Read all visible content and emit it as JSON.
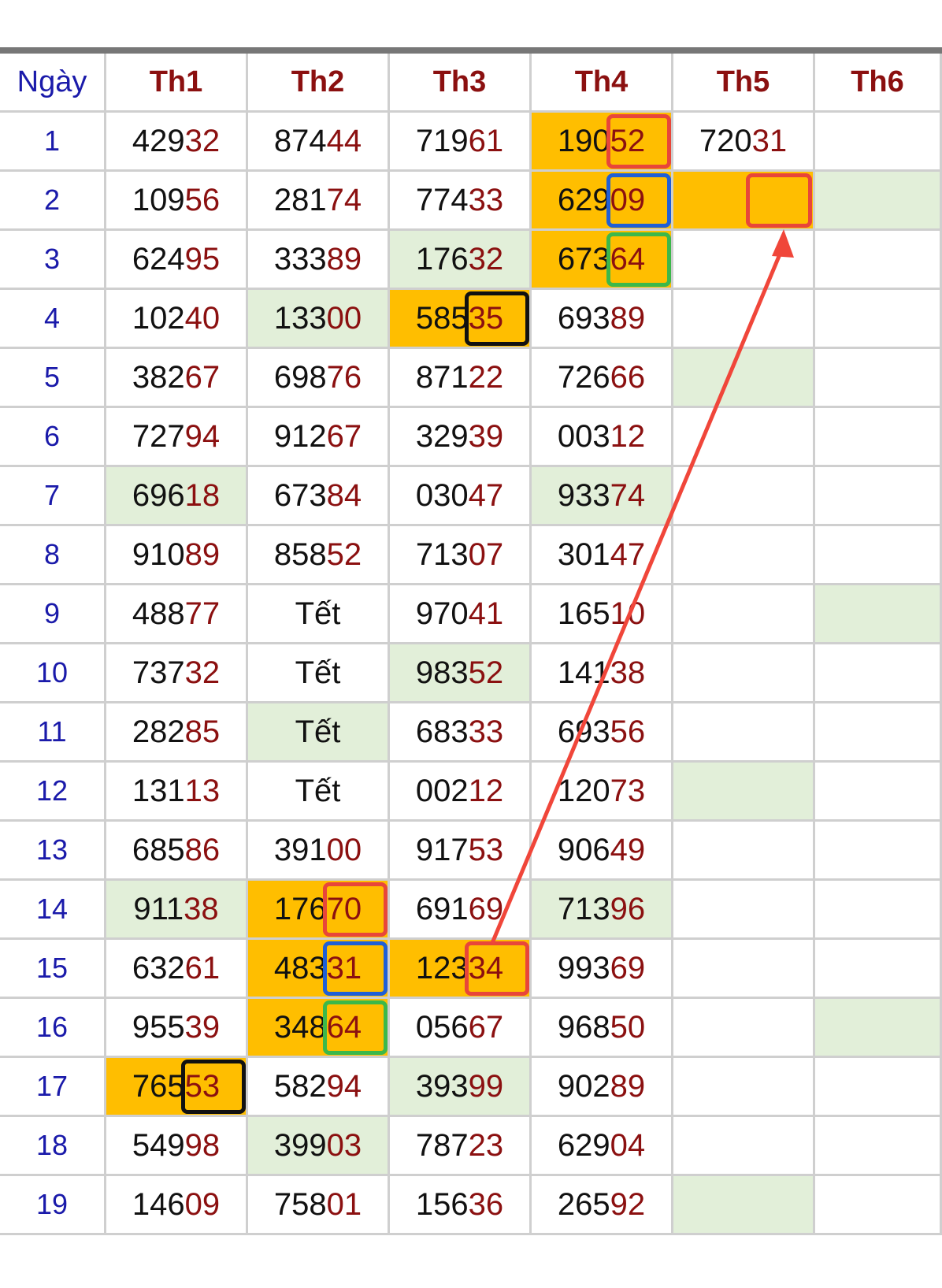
{
  "headers": [
    "Ngày",
    "Th1",
    "Th2",
    "Th3",
    "Th4",
    "Th5",
    "Th6"
  ],
  "rows": [
    {
      "day": "1",
      "values": [
        "42932",
        "87444",
        "71961",
        "19052",
        "72031",
        ""
      ]
    },
    {
      "day": "2",
      "values": [
        "10956",
        "28174",
        "77433",
        "62909",
        "",
        ""
      ]
    },
    {
      "day": "3",
      "values": [
        "62495",
        "33389",
        "17632",
        "67364",
        "",
        ""
      ]
    },
    {
      "day": "4",
      "values": [
        "10240",
        "13300",
        "58535",
        "69389",
        "",
        ""
      ]
    },
    {
      "day": "5",
      "values": [
        "38267",
        "69876",
        "87122",
        "72666",
        "",
        ""
      ]
    },
    {
      "day": "6",
      "values": [
        "72794",
        "91267",
        "32939",
        "00312",
        "",
        ""
      ]
    },
    {
      "day": "7",
      "values": [
        "69618",
        "67384",
        "03047",
        "93374",
        "",
        ""
      ]
    },
    {
      "day": "8",
      "values": [
        "91089",
        "85852",
        "71307",
        "30147",
        "",
        ""
      ]
    },
    {
      "day": "9",
      "values": [
        "48877",
        "Tết",
        "97041",
        "16510",
        "",
        ""
      ]
    },
    {
      "day": "10",
      "values": [
        "73732",
        "Tết",
        "98352",
        "14138",
        "",
        ""
      ]
    },
    {
      "day": "11",
      "values": [
        "28285",
        "Tết",
        "68333",
        "69356",
        "",
        ""
      ]
    },
    {
      "day": "12",
      "values": [
        "13113",
        "Tết",
        "00212",
        "12073",
        "",
        ""
      ]
    },
    {
      "day": "13",
      "values": [
        "68586",
        "39100",
        "91753",
        "90649",
        "",
        ""
      ]
    },
    {
      "day": "14",
      "values": [
        "91138",
        "17670",
        "69169",
        "71396",
        "",
        ""
      ]
    },
    {
      "day": "15",
      "values": [
        "63261",
        "48331",
        "12334",
        "99369",
        "",
        ""
      ]
    },
    {
      "day": "16",
      "values": [
        "95539",
        "34864",
        "05667",
        "96850",
        "",
        ""
      ]
    },
    {
      "day": "17",
      "values": [
        "76553",
        "58294",
        "39399",
        "90289",
        "",
        ""
      ]
    },
    {
      "day": "18",
      "values": [
        "54998",
        "39903",
        "78723",
        "62904",
        "",
        ""
      ]
    },
    {
      "day": "19",
      "values": [
        "14609",
        "75801",
        "15636",
        "26592",
        "",
        ""
      ]
    }
  ],
  "highlights": {
    "orange": [
      [
        1,
        4
      ],
      [
        2,
        4
      ],
      [
        2,
        5
      ],
      [
        3,
        4
      ],
      [
        4,
        3
      ],
      [
        14,
        2
      ],
      [
        15,
        2
      ],
      [
        15,
        3
      ],
      [
        16,
        2
      ],
      [
        17,
        1
      ]
    ],
    "green": [
      [
        2,
        6
      ],
      [
        3,
        3
      ],
      [
        4,
        2
      ],
      [
        5,
        5
      ],
      [
        7,
        1
      ],
      [
        7,
        4
      ],
      [
        9,
        6
      ],
      [
        10,
        3
      ],
      [
        11,
        2
      ],
      [
        12,
        5
      ],
      [
        14,
        1
      ],
      [
        14,
        4
      ],
      [
        16,
        6
      ],
      [
        17,
        3
      ],
      [
        18,
        2
      ],
      [
        19,
        5
      ]
    ]
  },
  "markers": [
    {
      "row": 1,
      "col": 4,
      "color": "#e8463a"
    },
    {
      "row": 2,
      "col": 4,
      "color": "#1f5fd6"
    },
    {
      "row": 3,
      "col": 4,
      "color": "#3cb84a"
    },
    {
      "row": 4,
      "col": 3,
      "color": "#111111"
    },
    {
      "row": 2,
      "col": 5,
      "color": "#e8463a",
      "full": true
    },
    {
      "row": 14,
      "col": 2,
      "color": "#e8463a"
    },
    {
      "row": 15,
      "col": 2,
      "color": "#1f5fd6"
    },
    {
      "row": 15,
      "col": 3,
      "color": "#e8463a"
    },
    {
      "row": 16,
      "col": 2,
      "color": "#3cb84a"
    },
    {
      "row": 17,
      "col": 1,
      "color": "#111111"
    }
  ],
  "arrow": {
    "from": {
      "row": 15,
      "col": 3
    },
    "to": {
      "row": 2,
      "col": 5
    },
    "color": "#f0463a"
  },
  "colors": {
    "orange": "#ffbe00",
    "green": "#e2efd9",
    "border": "#cfcfcf",
    "redDigits": "#8b1010",
    "blue": "#1a1aaa"
  }
}
